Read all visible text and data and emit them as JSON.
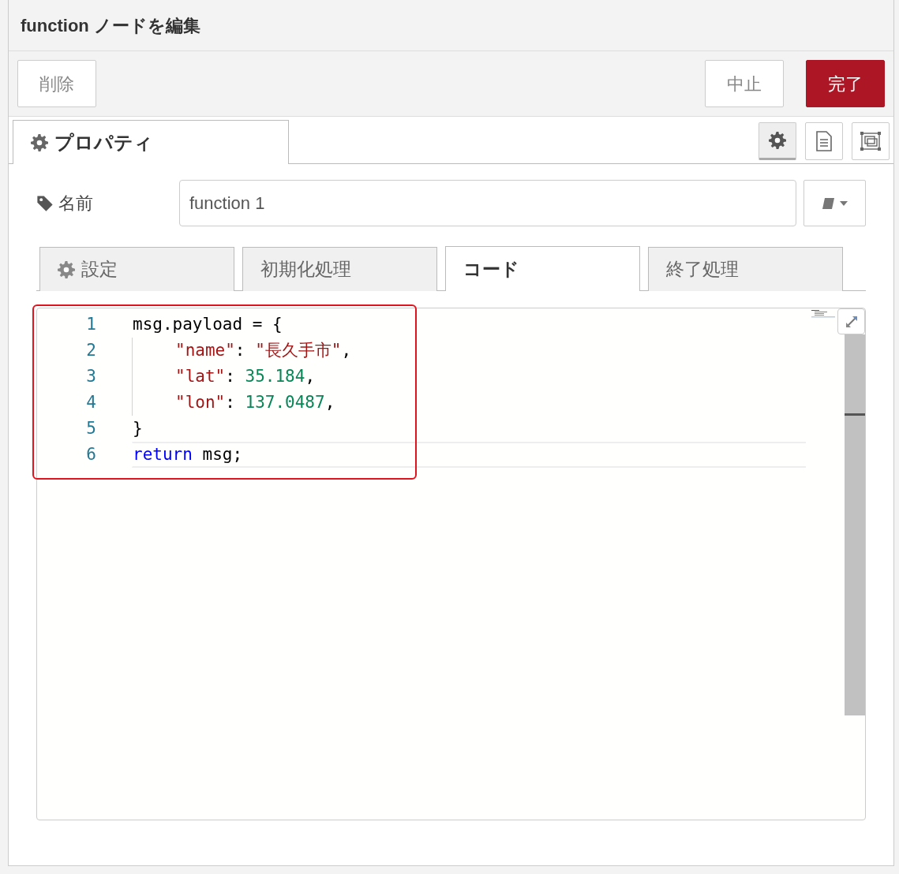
{
  "window": {
    "title": "function ノードを編集"
  },
  "toolbar": {
    "buttons": [
      {
        "label": "削除",
        "kind": "plain"
      },
      {
        "label": "中止",
        "kind": "plain"
      },
      {
        "label": "完了",
        "kind": "primary"
      }
    ]
  },
  "tabs": [
    {
      "label": "プロパティ",
      "selected": true
    }
  ],
  "side_tabs": [
    {
      "kind": "gear",
      "selected": true
    },
    {
      "kind": "document",
      "selected": false
    },
    {
      "kind": "frame",
      "selected": false
    }
  ],
  "name_field": {
    "label": "名前",
    "value": "function 1"
  },
  "inner_tabs": [
    {
      "label": "設定",
      "selected": false
    },
    {
      "label": "初期化処理",
      "selected": false
    },
    {
      "label": "コード",
      "selected": true
    },
    {
      "label": "終了処理",
      "selected": false
    }
  ],
  "code": {
    "highlighted": true,
    "lines": [
      {
        "number": "1",
        "indented": false,
        "current": false,
        "tokens": [
          {
            "kind": "plain",
            "text": "msg.payload = {"
          }
        ]
      },
      {
        "number": "2",
        "indented": true,
        "current": false,
        "tokens": [
          {
            "kind": "string",
            "text": "\"name\""
          },
          {
            "kind": "plain",
            "text": ": "
          },
          {
            "kind": "string",
            "text": "\"長久手市\""
          },
          {
            "kind": "plain",
            "text": ","
          }
        ]
      },
      {
        "number": "3",
        "indented": true,
        "current": false,
        "tokens": [
          {
            "kind": "string",
            "text": "\"lat\""
          },
          {
            "kind": "plain",
            "text": ": "
          },
          {
            "kind": "number",
            "text": "35.184"
          },
          {
            "kind": "plain",
            "text": ","
          }
        ]
      },
      {
        "number": "4",
        "indented": true,
        "current": false,
        "tokens": [
          {
            "kind": "string",
            "text": "\"lon\""
          },
          {
            "kind": "plain",
            "text": ": "
          },
          {
            "kind": "number",
            "text": "137.0487"
          },
          {
            "kind": "plain",
            "text": ","
          }
        ]
      },
      {
        "number": "5",
        "indented": false,
        "current": false,
        "tokens": [
          {
            "kind": "plain",
            "text": "}"
          }
        ]
      },
      {
        "number": "6",
        "indented": false,
        "current": true,
        "tokens": [
          {
            "kind": "keyword",
            "text": "return"
          },
          {
            "kind": "plain",
            "text": " msg;"
          }
        ]
      }
    ]
  }
}
